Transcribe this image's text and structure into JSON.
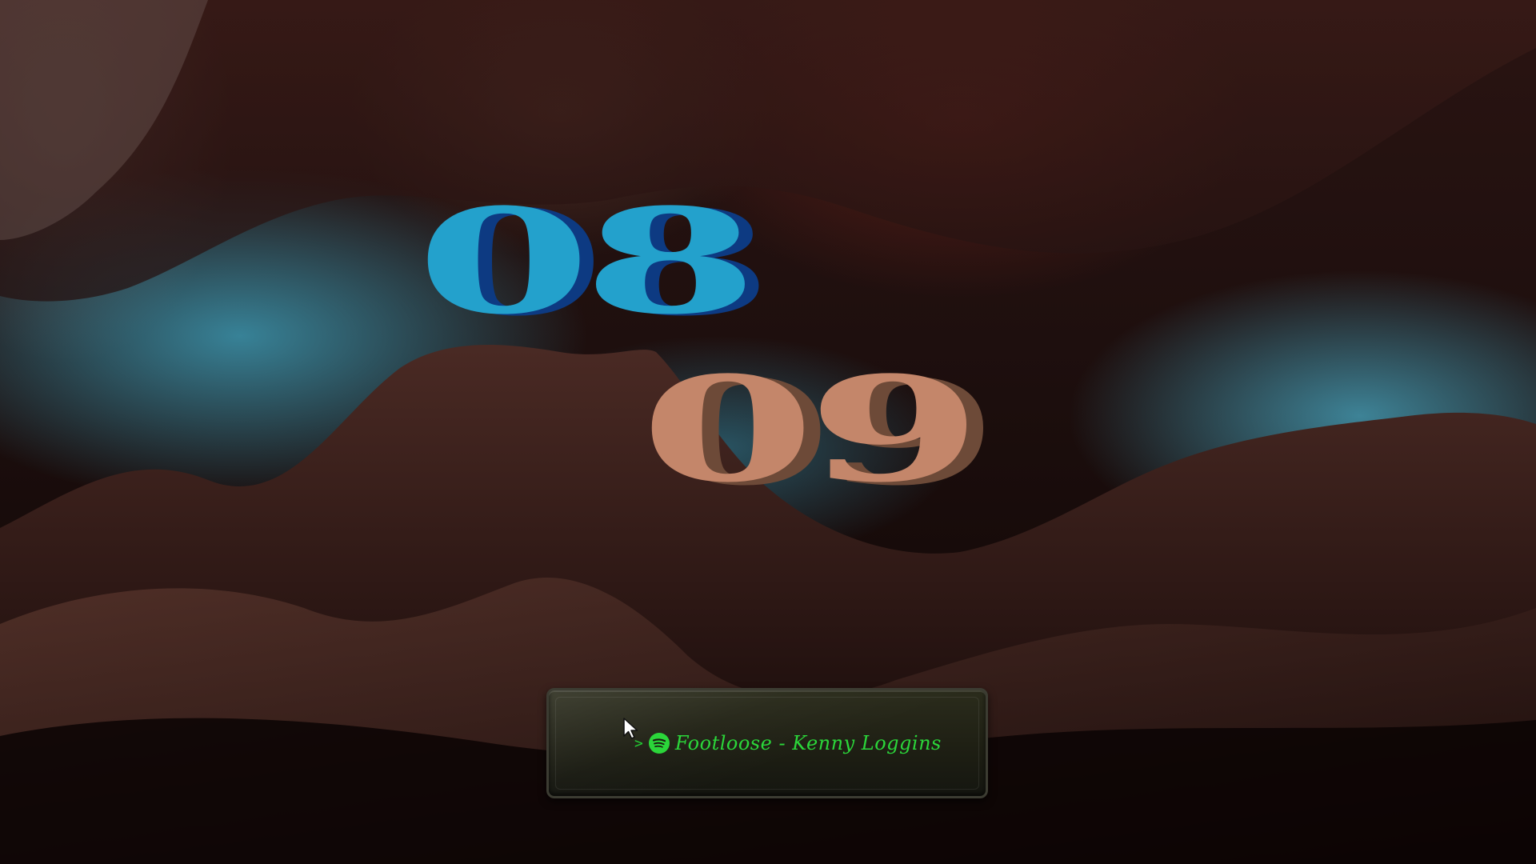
{
  "clock": {
    "hours": "08",
    "minutes": "09",
    "hours_color": "#23a1cc",
    "minutes_color": "#c4866a"
  },
  "media_widget": {
    "prompt_symbol": ">",
    "icon": "spotify-icon",
    "track_text": "Footloose - Kenny Loggins",
    "text_color": "#2bd63a"
  },
  "wallpaper": {
    "accent_colors": [
      "#3c96af",
      "#2a1412",
      "#070303"
    ]
  }
}
